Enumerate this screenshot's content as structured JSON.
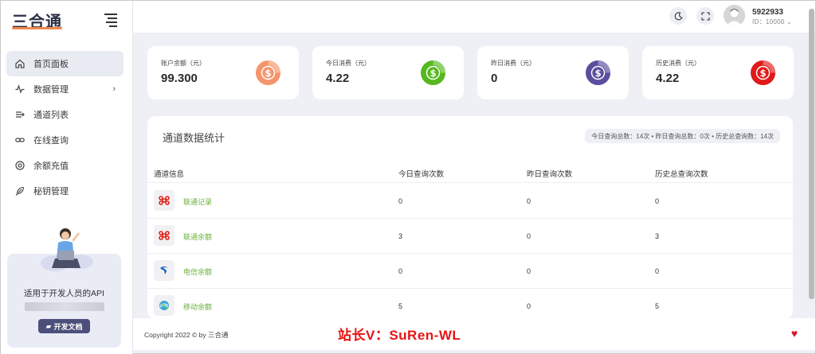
{
  "app": {
    "logo_text": "三合通"
  },
  "sidebar": {
    "items": [
      {
        "label": "首页面板",
        "icon": "home-icon",
        "active": true
      },
      {
        "label": "数据管理",
        "icon": "pulse-icon",
        "has_children": true
      },
      {
        "label": "通道列表",
        "icon": "list-arrow-icon"
      },
      {
        "label": "在线查询",
        "icon": "link-icon"
      },
      {
        "label": "余额充值",
        "icon": "target-icon"
      },
      {
        "label": "秘钥管理",
        "icon": "feather-icon"
      }
    ],
    "promo": {
      "text": "适用于开发人员的API",
      "button": "开发文档"
    }
  },
  "header": {
    "user_name": "5922933",
    "user_id": "ID：10000 ⌄"
  },
  "stats": [
    {
      "label": "账户余额（元）",
      "value": "99.300",
      "color": "#f5956b"
    },
    {
      "label": "今日消费（元）",
      "value": "4.22",
      "color": "#56b81f"
    },
    {
      "label": "昨日消费（元）",
      "value": "0",
      "color": "#5a4e9e"
    },
    {
      "label": "历史消费（元）",
      "value": "4.22",
      "color": "#e01a1a"
    }
  ],
  "panel": {
    "title": "通道数据统计",
    "summary": "今日查询总数：14次 • 昨日查询总数：0次 • 历史总查询数：14次",
    "columns": [
      "通道信息",
      "今日查询次数",
      "昨日查询次数",
      "历史总查询次数"
    ],
    "rows": [
      {
        "name": "联通记录",
        "logo": "unicom-icon",
        "today": "0",
        "yesterday": "0",
        "total": "0"
      },
      {
        "name": "联通余额",
        "logo": "unicom-icon",
        "today": "3",
        "yesterday": "0",
        "total": "3"
      },
      {
        "name": "电信余额",
        "logo": "telecom-icon",
        "today": "0",
        "yesterday": "0",
        "total": "0"
      },
      {
        "name": "移动余额",
        "logo": "mobile-icon",
        "today": "5",
        "yesterday": "0",
        "total": "5"
      }
    ]
  },
  "footer": {
    "copyright": "Copyright 2022 © by 三合通",
    "watermark": "站长V：SuRen-WL"
  }
}
